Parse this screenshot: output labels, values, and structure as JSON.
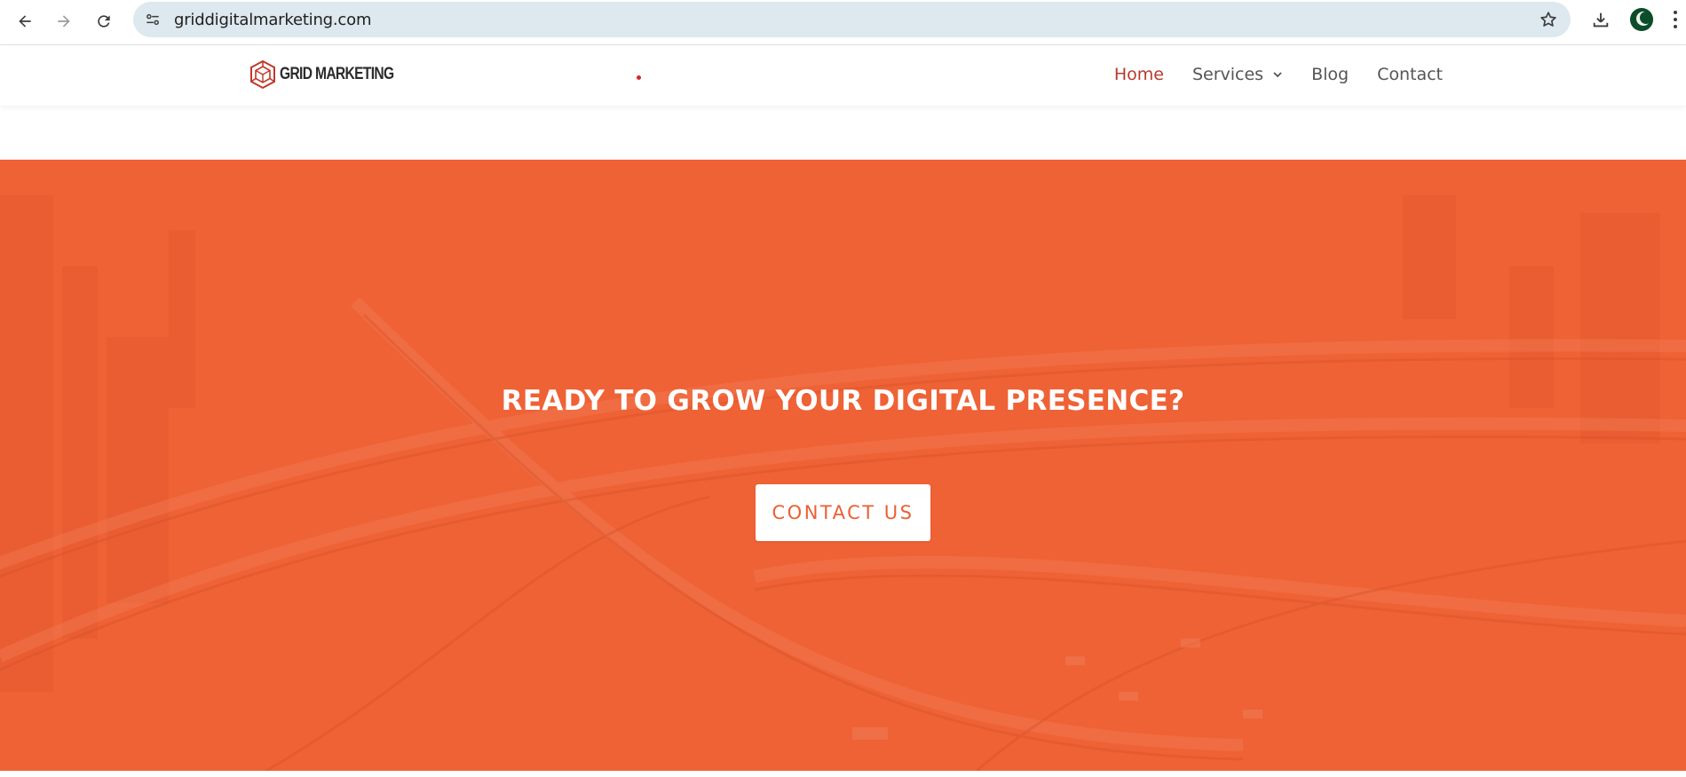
{
  "browser": {
    "url": "griddigitalmarketing.com"
  },
  "header": {
    "logo_text": "GRID MARKETING",
    "nav": [
      {
        "label": "Home",
        "active": true
      },
      {
        "label": "Services",
        "has_dropdown": true
      },
      {
        "label": "Blog"
      },
      {
        "label": "Contact"
      }
    ]
  },
  "hero": {
    "title": "READY TO GROW YOUR DIGITAL PRESENCE?",
    "button_label": "CONTACT US"
  },
  "colors": {
    "hero_bg": "#ef6236",
    "nav_active": "#b83a2c",
    "button_text": "#ec5f33"
  }
}
